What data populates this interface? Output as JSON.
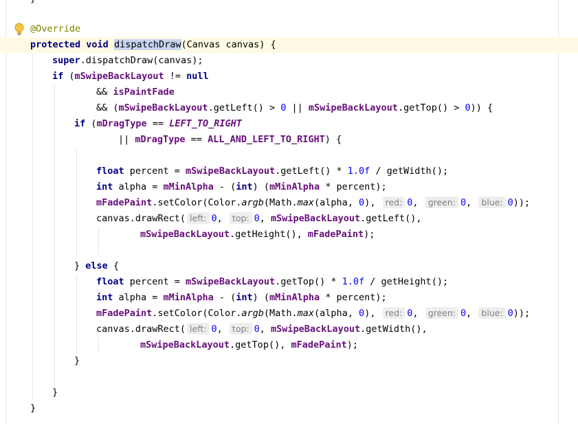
{
  "editor": {
    "top_partial": "}",
    "annotation": "@Override",
    "line_sig": {
      "kw1": "protected",
      "kw2": "void",
      "name": "dispatchDraw",
      "rest": "(Canvas canvas) {"
    },
    "line_super": {
      "kw": "super",
      "rest": ".dispatchDraw(canvas);"
    },
    "line_if1": {
      "kw": "if",
      "p1": " (",
      "fld": "mSwipeBackLayout",
      "op": " != ",
      "kw2": "null"
    },
    "line_and1": {
      "op": "&& ",
      "fld": "isPaintFade"
    },
    "line_and2": {
      "op": "&& (",
      "fld1": "mSwipeBackLayout",
      "m1": ".getLeft() > ",
      "n1": "0",
      "or": " || ",
      "fld2": "mSwipeBackLayout",
      "m2": ".getTop() > ",
      "n2": "0",
      "end": ")) {"
    },
    "line_if2": {
      "kw": "if",
      "p": " (",
      "fld": "mDragType",
      "op": " == ",
      "const": "LEFT_TO_RIGHT"
    },
    "line_or2": {
      "op": "|| ",
      "fld": "mDragType",
      "op2": " == ",
      "const": "ALL_AND_LEFT_TO_RIGHT",
      "end": ") {"
    },
    "block1": {
      "float_kw": "float",
      "percent_a": " percent = ",
      "fld": "mSwipeBackLayout",
      "mid": ".getLeft() * ",
      "num": "1.0f",
      "end": " / getWidth();",
      "int_kw": "int",
      "alpha_a": " alpha = ",
      "fld_min": "mMinAlpha",
      "minus": " - (",
      "int_kw2": "int",
      "close": ") (",
      "fld_min2": "mMinAlpha",
      "mul": " * percent);",
      "fade": "mFadePaint",
      "setcolor": ".setColor(Color.",
      "argb": "argb",
      "mathp": "(Math.",
      "max": "max",
      "alpha0": "(alpha, ",
      "zero1": "0",
      "comma": "), ",
      "hint_red": "red:",
      "zero2": "0",
      "hint_green": "green:",
      "zero3": "0",
      "hint_blue": "blue:",
      "zero4": "0",
      "endcolor": "));",
      "draw": "canvas.drawRect(",
      "hint_left": "left:",
      "z5": "0",
      "hint_top": "top:",
      "z6": "0",
      "fld2": "mSwipeBackLayout",
      "gl": ".getLeft(),",
      "fld3": "mSwipeBackLayout",
      "gh": ".getHeight(), ",
      "fade2": "mFadePaint",
      "end2": ");"
    },
    "else_line": {
      "brace": "} ",
      "kw": "else",
      "rest": " {"
    },
    "block2": {
      "float_kw": "float",
      "percent_a": " percent = ",
      "fld": "mSwipeBackLayout",
      "mid": ".getTop() * ",
      "num": "1.0f",
      "end": " / getHeight();",
      "int_kw": "int",
      "alpha_a": " alpha = ",
      "fld_min": "mMinAlpha",
      "minus": " - (",
      "int_kw2": "int",
      "close": ") (",
      "fld_min2": "mMinAlpha",
      "mul": " * percent);",
      "fade": "mFadePaint",
      "setcolor": ".setColor(Color.",
      "argb": "argb",
      "mathp": "(Math.",
      "max": "max",
      "alpha0": "(alpha, ",
      "zero1": "0",
      "comma": "), ",
      "hint_red": "red:",
      "zero2": "0",
      "hint_green": "green:",
      "zero3": "0",
      "hint_blue": "blue:",
      "zero4": "0",
      "endcolor": "));",
      "draw": "canvas.drawRect(",
      "hint_left": "left:",
      "z5": "0",
      "hint_top": "top:",
      "z6": "0",
      "fld2": "mSwipeBackLayout",
      "gw": ".getWidth(),",
      "fld3": "mSwipeBackLayout",
      "gt": ".getTop(), ",
      "fade2": "mFadePaint",
      "end2": ");"
    },
    "close1": "}",
    "close2": "}",
    "close3": "}"
  },
  "colors": {
    "keyword": "#000080",
    "field": "#660e7a",
    "number": "#0000ff",
    "annotation": "#808000",
    "current_line": "#fffae3",
    "selection": "#c9d4f0"
  },
  "icons": {
    "bulb": "lightbulb-icon",
    "fold": "fold-marker-icon"
  }
}
